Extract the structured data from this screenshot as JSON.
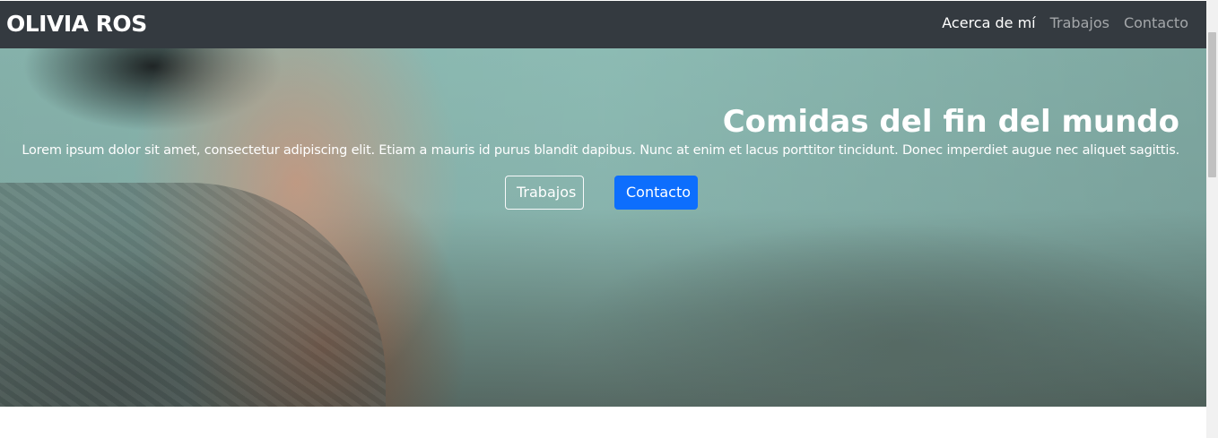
{
  "navbar": {
    "brand": "OLIVIA ROS",
    "links": [
      {
        "label": "Acerca de mí",
        "active": true
      },
      {
        "label": "Trabajos",
        "active": false
      },
      {
        "label": "Contacto",
        "active": false
      }
    ]
  },
  "hero": {
    "title": "Comidas del fin del mundo",
    "text": "Lorem ipsum dolor sit amet, consectetur adipiscing elit. Etiam a mauris id purus blandit dapibus. Nunc at enim et lacus porttitor tincidunt. Donec imperdiet augue nec aliquet sagittis.",
    "buttons": {
      "secondary": "Trabajos",
      "primary": "Contacto"
    }
  },
  "colors": {
    "navbar_bg": "#343a40",
    "primary": "#0d6efd",
    "text_light": "#ffffff"
  }
}
